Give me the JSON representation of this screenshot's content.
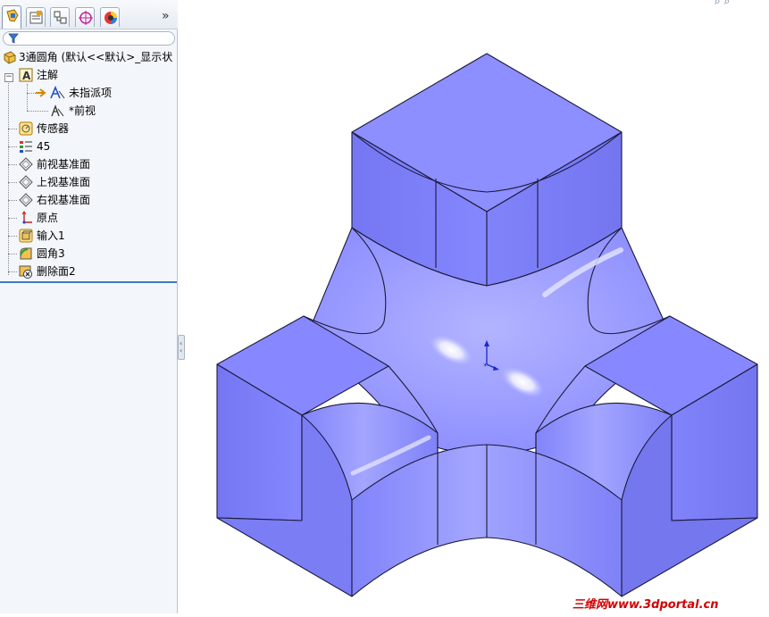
{
  "panel": {
    "tabs": [
      {
        "name": "feature-manager",
        "icon": "feature-tree-icon",
        "active": true
      },
      {
        "name": "property-manager",
        "icon": "property-manager-icon",
        "active": false
      },
      {
        "name": "configuration-manager",
        "icon": "configuration-icon",
        "active": false
      },
      {
        "name": "dimxpert-manager",
        "icon": "dimxpert-icon",
        "active": false
      },
      {
        "name": "display-manager",
        "icon": "display-manager-icon",
        "active": false
      }
    ],
    "more_icon": "»",
    "filter_icon": "filter-icon"
  },
  "tree": {
    "root": "3通圆角  (默认<<默认>_显示状",
    "items": [
      {
        "label": "注解",
        "icon": "annotations-icon"
      },
      {
        "label": "未指派项",
        "icon": "unassigned-annotation-icon"
      },
      {
        "label": "*前视",
        "icon": "annotation-view-icon"
      },
      {
        "label": "传感器",
        "icon": "sensor-icon"
      },
      {
        "label": "45",
        "icon": "material-icon"
      },
      {
        "label": "前视基准面",
        "icon": "plane-icon"
      },
      {
        "label": "上视基准面",
        "icon": "plane-icon"
      },
      {
        "label": "右视基准面",
        "icon": "plane-icon"
      },
      {
        "label": "原点",
        "icon": "origin-icon"
      },
      {
        "label": "输入1",
        "icon": "imported-body-icon"
      },
      {
        "label": "圆角3",
        "icon": "fillet-icon"
      },
      {
        "label": "删除面2",
        "icon": "delete-face-icon"
      }
    ]
  },
  "viewport": {
    "model_color": "#8b8cff",
    "edge_color": "#1a1a3a"
  },
  "watermark": "三维网www.3dportal.cn"
}
